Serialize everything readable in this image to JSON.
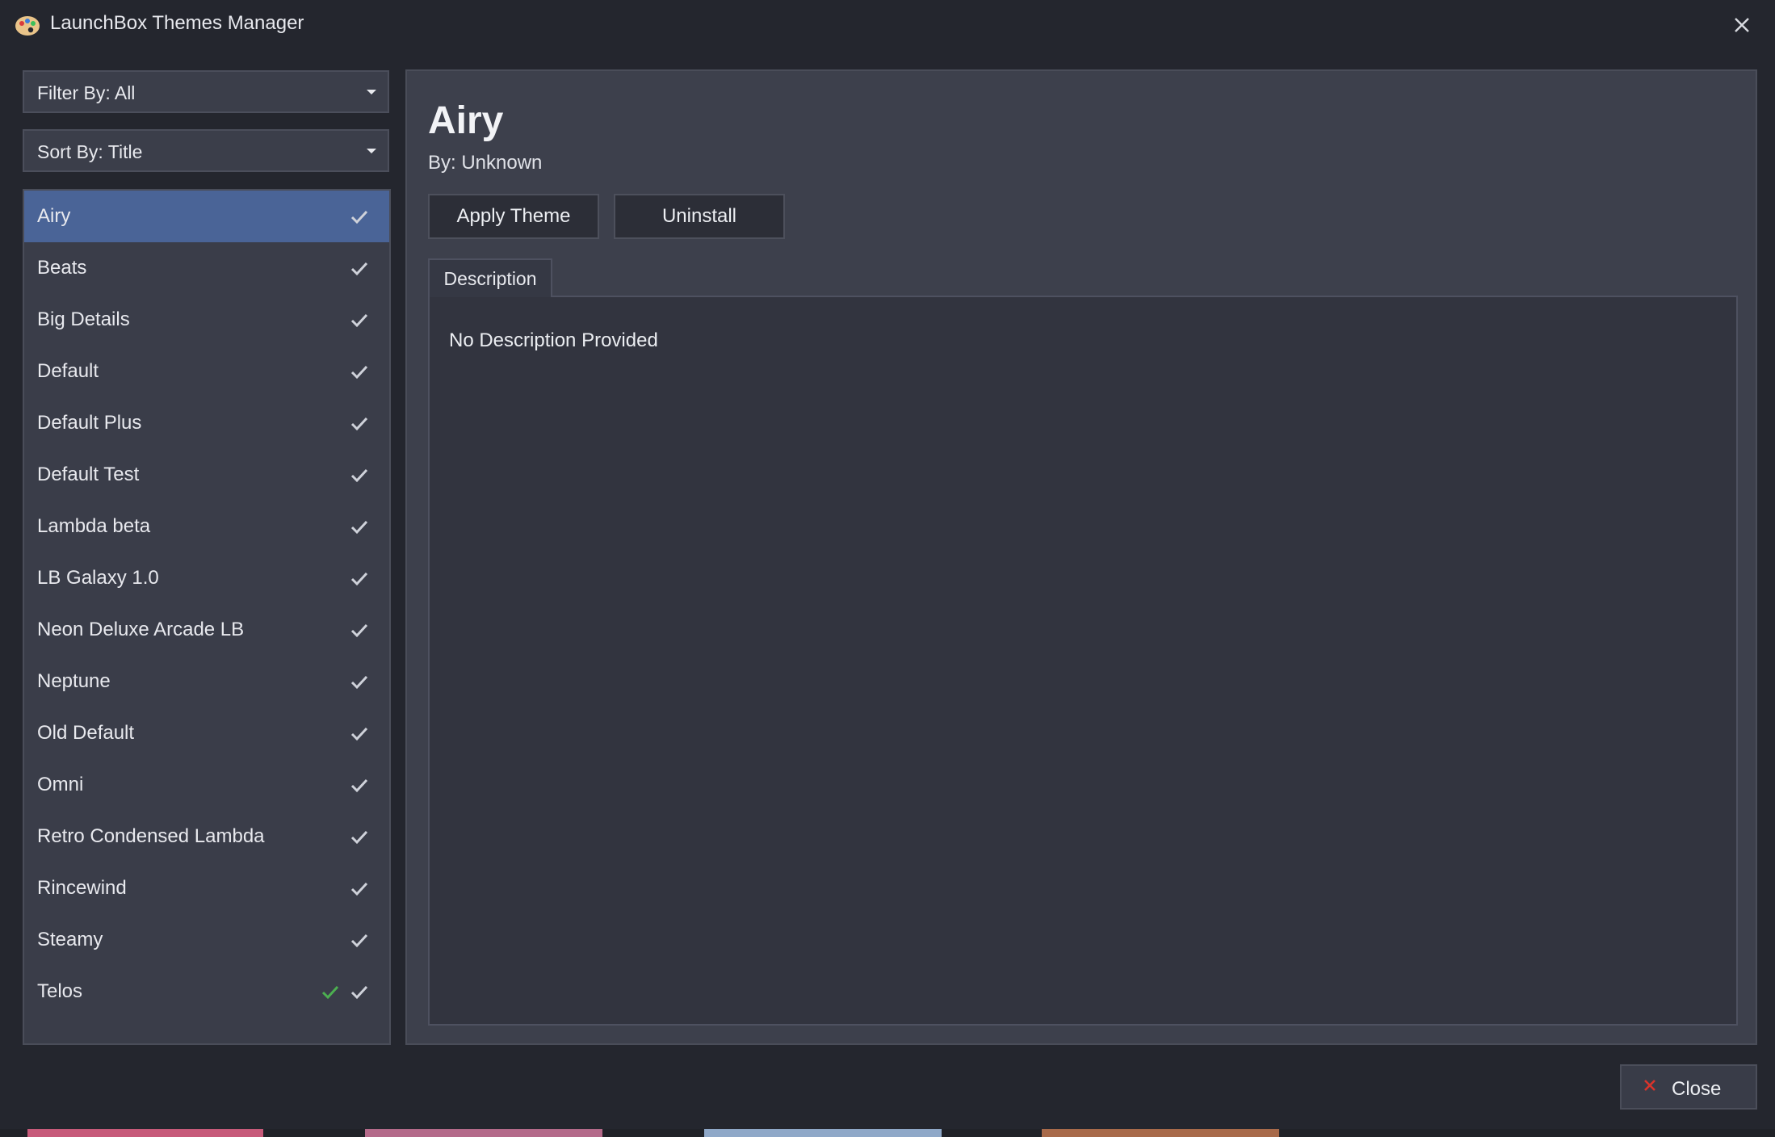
{
  "window": {
    "title": "LaunchBox Themes Manager"
  },
  "filters": {
    "filter_label": "Filter By: All",
    "sort_label": "Sort By: Title"
  },
  "themes": [
    {
      "name": "Airy",
      "selected": true
    },
    {
      "name": "Beats"
    },
    {
      "name": "Big Details"
    },
    {
      "name": "Default"
    },
    {
      "name": "Default Plus"
    },
    {
      "name": "Default Test"
    },
    {
      "name": "Lambda beta"
    },
    {
      "name": "LB Galaxy 1.0"
    },
    {
      "name": "Neon Deluxe Arcade LB"
    },
    {
      "name": "Neptune"
    },
    {
      "name": "Old Default"
    },
    {
      "name": "Omni"
    },
    {
      "name": "Retro Condensed Lambda"
    },
    {
      "name": "Rincewind"
    },
    {
      "name": "Steamy"
    },
    {
      "name": "Telos",
      "active": true
    }
  ],
  "detail": {
    "title": "Airy",
    "author": "By: Unknown",
    "apply_label": "Apply Theme",
    "uninstall_label": "Uninstall",
    "tab_label": "Description",
    "description": "No Description Provided"
  },
  "footer": {
    "close_label": "Close"
  },
  "colors": {
    "background": "#24262e",
    "panel": "#3d404c",
    "selected_row": "#4a6497",
    "active_check": "#4caf50",
    "close_icon": "#d9342b"
  },
  "icons": {
    "app": "palette-icon",
    "window_close": "close-icon",
    "installed": "checkmark-icon",
    "active": "active-checkmark-icon",
    "close_button": "red-x-icon"
  }
}
